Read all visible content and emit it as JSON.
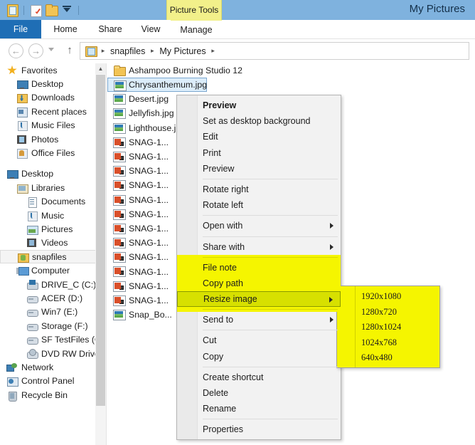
{
  "window": {
    "title": "My Pictures",
    "contextual_tab_group": "Picture Tools"
  },
  "quick_access_toolbar": {
    "items": [
      {
        "icon": "properties-icon",
        "label": "Properties"
      },
      {
        "icon": "new-folder-icon",
        "label": "New folder"
      },
      {
        "icon": "folder-icon",
        "label": "Folder"
      },
      {
        "icon": "chevron-down-icon",
        "label": "Customize Quick Access Toolbar"
      }
    ]
  },
  "ribbon": {
    "tabs": [
      {
        "label": "File",
        "active": true
      },
      {
        "label": "Home",
        "active": false
      },
      {
        "label": "Share",
        "active": false
      },
      {
        "label": "View",
        "active": false
      },
      {
        "label": "Manage",
        "active": false
      }
    ]
  },
  "address_bar": {
    "back_glyph": "←",
    "forward_glyph": "→",
    "up_glyph": "↑",
    "breadcrumbs": [
      "snapfiles",
      "My Pictures"
    ],
    "separator": "▸"
  },
  "nav_pane": {
    "items": [
      {
        "label": "Favorites",
        "icon": "star-icon",
        "indent": 0,
        "selected": false
      },
      {
        "label": "Desktop",
        "icon": "monitor-icon",
        "indent": 1,
        "selected": false
      },
      {
        "label": "Downloads",
        "icon": "downloads-folder-icon",
        "indent": 1,
        "selected": false
      },
      {
        "label": "Recent places",
        "icon": "recent-places-icon",
        "indent": 1,
        "selected": false
      },
      {
        "label": "Music Files",
        "icon": "music-note-icon",
        "indent": 1,
        "selected": false
      },
      {
        "label": "Photos",
        "icon": "photos-icon",
        "indent": 1,
        "selected": false
      },
      {
        "label": "Office Files",
        "icon": "office-files-icon",
        "indent": 1,
        "selected": false
      },
      {
        "label": "Desktop",
        "icon": "monitor-icon",
        "indent": 0,
        "selected": false,
        "spacer_before": true
      },
      {
        "label": "Libraries",
        "icon": "libraries-icon",
        "indent": 1,
        "selected": false
      },
      {
        "label": "Documents",
        "icon": "document-icon",
        "indent": 2,
        "selected": false
      },
      {
        "label": "Music",
        "icon": "music-note-icon",
        "indent": 2,
        "selected": false
      },
      {
        "label": "Pictures",
        "icon": "pictures-icon",
        "indent": 2,
        "selected": false
      },
      {
        "label": "Videos",
        "icon": "videos-icon",
        "indent": 2,
        "selected": false
      },
      {
        "label": "snapfiles",
        "icon": "user-folder-icon",
        "indent": 1,
        "selected": true
      },
      {
        "label": "Computer",
        "icon": "computer-icon",
        "indent": 1,
        "selected": false
      },
      {
        "label": "DRIVE_C (C:)",
        "icon": "system-drive-icon",
        "indent": 2,
        "selected": false
      },
      {
        "label": "ACER (D:)",
        "icon": "hard-drive-icon",
        "indent": 2,
        "selected": false
      },
      {
        "label": "Win7 (E:)",
        "icon": "hard-drive-icon",
        "indent": 2,
        "selected": false
      },
      {
        "label": "Storage (F:)",
        "icon": "hard-drive-icon",
        "indent": 2,
        "selected": false
      },
      {
        "label": "SF TestFiles (G:)",
        "icon": "hard-drive-icon",
        "indent": 2,
        "selected": false
      },
      {
        "label": "DVD RW Drive (",
        "icon": "dvd-drive-icon",
        "indent": 2,
        "selected": false
      },
      {
        "label": "Network",
        "icon": "network-icon",
        "indent": 0,
        "selected": false
      },
      {
        "label": "Control Panel",
        "icon": "control-panel-icon",
        "indent": 0,
        "selected": false
      },
      {
        "label": "Recycle Bin",
        "icon": "recycle-bin-icon",
        "indent": 0,
        "selected": false
      }
    ]
  },
  "file_list": {
    "items": [
      {
        "name": "Ashampoo Burning Studio 12",
        "icon": "folder-icon",
        "selected": false
      },
      {
        "name": "Chrysanthemum.jpg",
        "icon": "image-icon",
        "selected": true
      },
      {
        "name": "Desert.jpg",
        "icon": "image-icon",
        "selected": false
      },
      {
        "name": "Jellyfish.jpg",
        "icon": "image-icon",
        "selected": false
      },
      {
        "name": "Lighthouse.jpg",
        "icon": "image-icon",
        "selected": false
      },
      {
        "name": "SNAG-1...",
        "icon": "snagit-icon",
        "selected": false
      },
      {
        "name": "SNAG-1...",
        "icon": "snagit-icon",
        "selected": false
      },
      {
        "name": "SNAG-1...",
        "icon": "snagit-icon",
        "selected": false
      },
      {
        "name": "SNAG-1...",
        "icon": "snagit-icon",
        "selected": false
      },
      {
        "name": "SNAG-1...",
        "icon": "snagit-icon",
        "selected": false
      },
      {
        "name": "SNAG-1...",
        "icon": "snagit-icon",
        "selected": false
      },
      {
        "name": "SNAG-1...",
        "icon": "snagit-icon",
        "selected": false
      },
      {
        "name": "SNAG-1...",
        "icon": "snagit-icon",
        "selected": false
      },
      {
        "name": "SNAG-1...",
        "icon": "snagit-icon",
        "selected": false
      },
      {
        "name": "SNAG-1...",
        "icon": "snagit-icon",
        "selected": false
      },
      {
        "name": "SNAG-1...",
        "icon": "snagit-icon",
        "selected": false
      },
      {
        "name": "SNAG-1...",
        "icon": "snagit-icon",
        "selected": false
      },
      {
        "name": "Snap_Bo...",
        "icon": "image-icon",
        "selected": false
      }
    ]
  },
  "context_menu": {
    "items": [
      {
        "label": "Preview",
        "type": "item",
        "bold": true,
        "submenu": false,
        "highlight": "none"
      },
      {
        "label": "Set as desktop background",
        "type": "item",
        "bold": false,
        "submenu": false,
        "highlight": "none"
      },
      {
        "label": "Edit",
        "type": "item",
        "bold": false,
        "submenu": false,
        "highlight": "none"
      },
      {
        "label": "Print",
        "type": "item",
        "bold": false,
        "submenu": false,
        "highlight": "none"
      },
      {
        "label": "Preview",
        "type": "item",
        "bold": false,
        "submenu": false,
        "highlight": "none"
      },
      {
        "label": "",
        "type": "sep",
        "highlight": "none"
      },
      {
        "label": "Rotate right",
        "type": "item",
        "bold": false,
        "submenu": false,
        "highlight": "none"
      },
      {
        "label": "Rotate left",
        "type": "item",
        "bold": false,
        "submenu": false,
        "highlight": "none"
      },
      {
        "label": "",
        "type": "sep",
        "highlight": "none"
      },
      {
        "label": "Open with",
        "type": "item",
        "bold": false,
        "submenu": true,
        "highlight": "none"
      },
      {
        "label": "",
        "type": "sep",
        "highlight": "none"
      },
      {
        "label": "Share with",
        "type": "item",
        "bold": false,
        "submenu": true,
        "highlight": "none"
      },
      {
        "label": "",
        "type": "sep",
        "highlight": "yellow"
      },
      {
        "label": "File note",
        "type": "item",
        "bold": false,
        "submenu": false,
        "highlight": "yellow"
      },
      {
        "label": "Copy path",
        "type": "item",
        "bold": false,
        "submenu": false,
        "highlight": "yellow"
      },
      {
        "label": "Resize image",
        "type": "item",
        "bold": false,
        "submenu": true,
        "highlight": "selected"
      },
      {
        "label": "",
        "type": "sep",
        "highlight": "yellow"
      },
      {
        "label": "Send to",
        "type": "item",
        "bold": false,
        "submenu": true,
        "highlight": "none"
      },
      {
        "label": "",
        "type": "sep",
        "highlight": "none"
      },
      {
        "label": "Cut",
        "type": "item",
        "bold": false,
        "submenu": false,
        "highlight": "none"
      },
      {
        "label": "Copy",
        "type": "item",
        "bold": false,
        "submenu": false,
        "highlight": "none"
      },
      {
        "label": "",
        "type": "sep",
        "highlight": "none"
      },
      {
        "label": "Create shortcut",
        "type": "item",
        "bold": false,
        "submenu": false,
        "highlight": "none"
      },
      {
        "label": "Delete",
        "type": "item",
        "bold": false,
        "submenu": false,
        "highlight": "none"
      },
      {
        "label": "Rename",
        "type": "item",
        "bold": false,
        "submenu": false,
        "highlight": "none"
      },
      {
        "label": "",
        "type": "sep",
        "highlight": "none"
      },
      {
        "label": "Properties",
        "type": "item",
        "bold": false,
        "submenu": false,
        "highlight": "none"
      }
    ]
  },
  "resize_submenu": {
    "items": [
      {
        "label": "1920x1080"
      },
      {
        "label": "1280x720"
      },
      {
        "label": "1280x1024"
      },
      {
        "label": "1024x768"
      },
      {
        "label": "640x480"
      }
    ]
  },
  "colors": {
    "titlebar": "#7fb2de",
    "file_tab": "#1f6eb5",
    "picture_tools": "#f2f08a",
    "highlight_yellow": "#f5f500",
    "highlight_selected": "#d7e000",
    "selection_blue": "#dcedfa"
  }
}
